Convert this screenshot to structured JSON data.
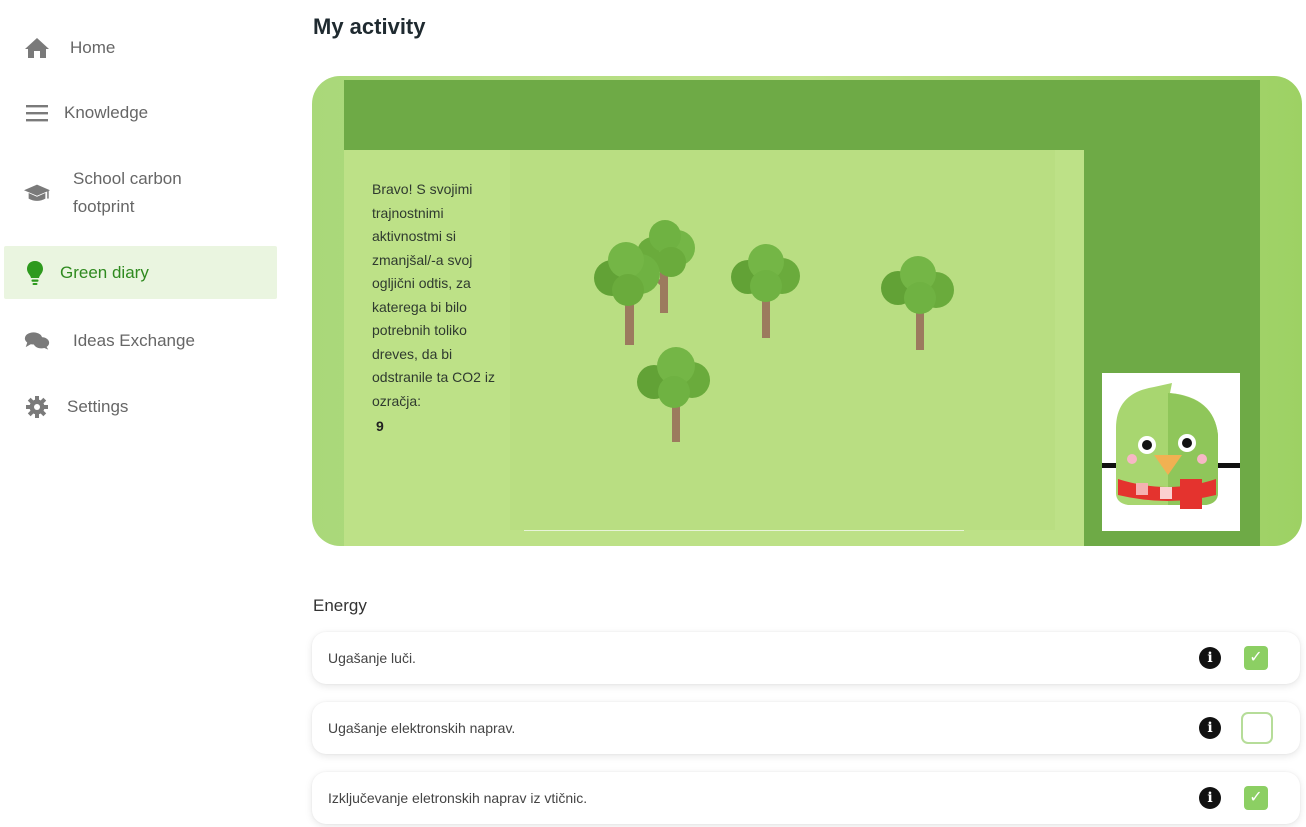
{
  "sidebar": {
    "items": [
      {
        "label": "Home",
        "icon": "home-icon"
      },
      {
        "label": "Knowledge",
        "icon": "menu-icon"
      },
      {
        "label": "School carbon footprint",
        "icon": "graduation-cap-icon"
      },
      {
        "label": "Green diary",
        "icon": "lightbulb-icon",
        "active": true
      },
      {
        "label": "Ideas Exchange",
        "icon": "chat-bubbles-icon"
      },
      {
        "label": "Settings",
        "icon": "gear-icon"
      }
    ]
  },
  "main": {
    "title": "My activity",
    "banner": {
      "message": "Bravo! S svojimi trajnostnimi aktivnostmi si zmanjšal/-a svoj ogljični odtis, za katerega bi bilo potrebnih toliko dreves, da bi odstranile ta CO2 iz ozračja:",
      "tree_count": "9"
    },
    "energy": {
      "section_label": "Energy",
      "activities": [
        {
          "label": "Ugašanje luči.",
          "checked": true
        },
        {
          "label": "Ugašanje elektronskih naprav.",
          "checked": false
        },
        {
          "label": "Izključevanje eletronskih naprav iz vtičnic.",
          "checked": true
        }
      ]
    }
  },
  "colors": {
    "accent_green": "#6eaa46",
    "active_text": "#2f8a1f",
    "checkbox_on": "#8ccf63"
  }
}
